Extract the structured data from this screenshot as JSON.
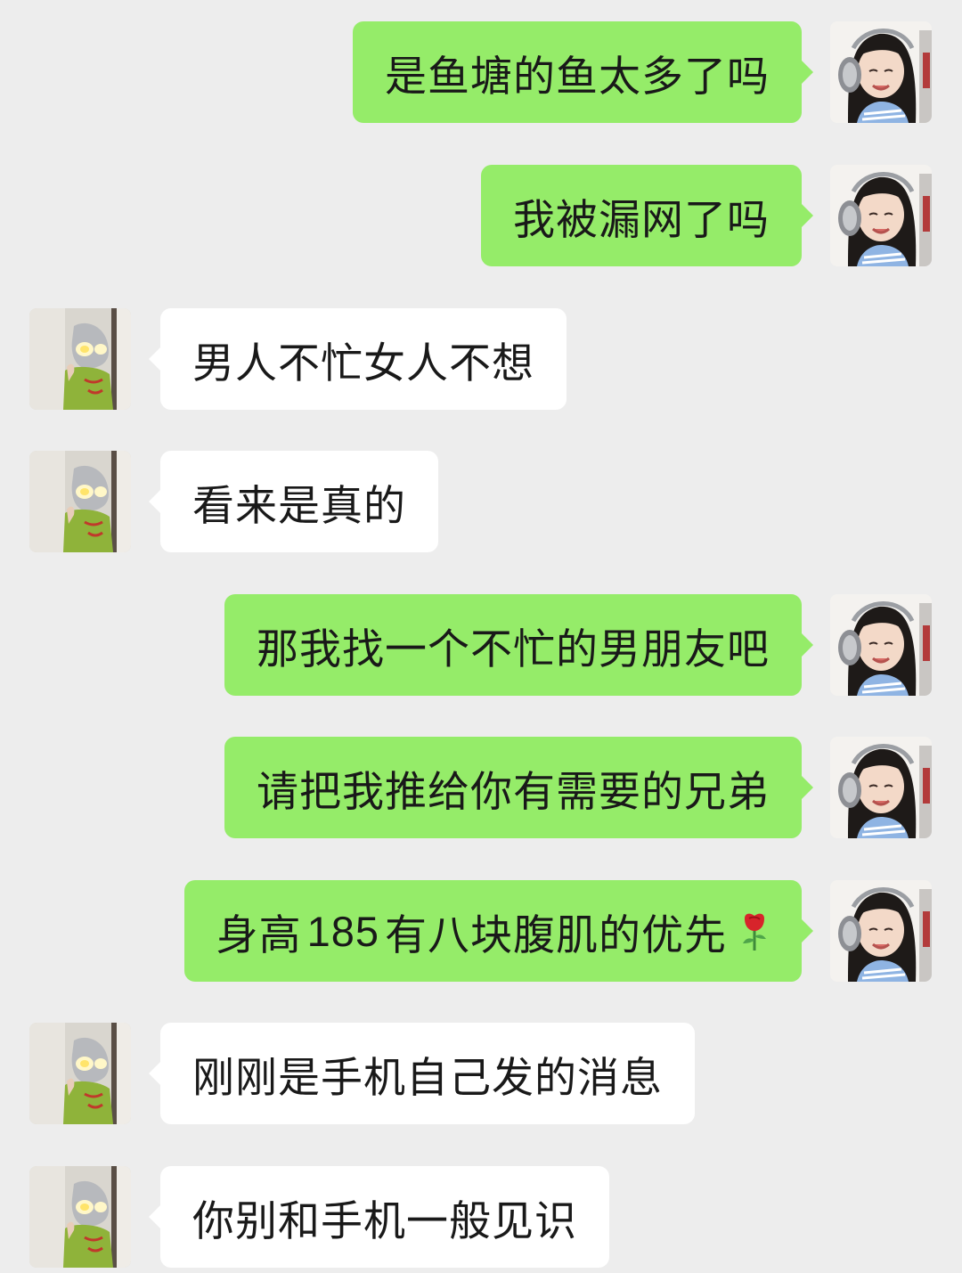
{
  "messages": [
    {
      "side": "out",
      "text": "是鱼塘的鱼太多了吗"
    },
    {
      "side": "out",
      "text": "我被漏网了吗"
    },
    {
      "side": "in",
      "text": "男人不忙女人不想"
    },
    {
      "side": "in",
      "text": "看来是真的"
    },
    {
      "side": "out",
      "text": "那我找一个不忙的男朋友吧"
    },
    {
      "side": "out",
      "text": "请把我推给你有需要的兄弟"
    },
    {
      "side": "out",
      "text_prefix": "身高",
      "text_number": "185",
      "text_suffix": "有八块腹肌的优先",
      "emoji": "rose-emoji"
    },
    {
      "side": "in",
      "text": "刚刚是手机自己发的消息"
    },
    {
      "side": "in",
      "text": "你别和手机一般见识"
    }
  ],
  "colors": {
    "background": "#ededed",
    "outgoing_bubble": "#95ec69",
    "incoming_bubble": "#ffffff",
    "text": "#191919"
  },
  "avatars": {
    "self": "girl-with-headphones-avatar",
    "contact": "ultraman-figure-avatar"
  }
}
